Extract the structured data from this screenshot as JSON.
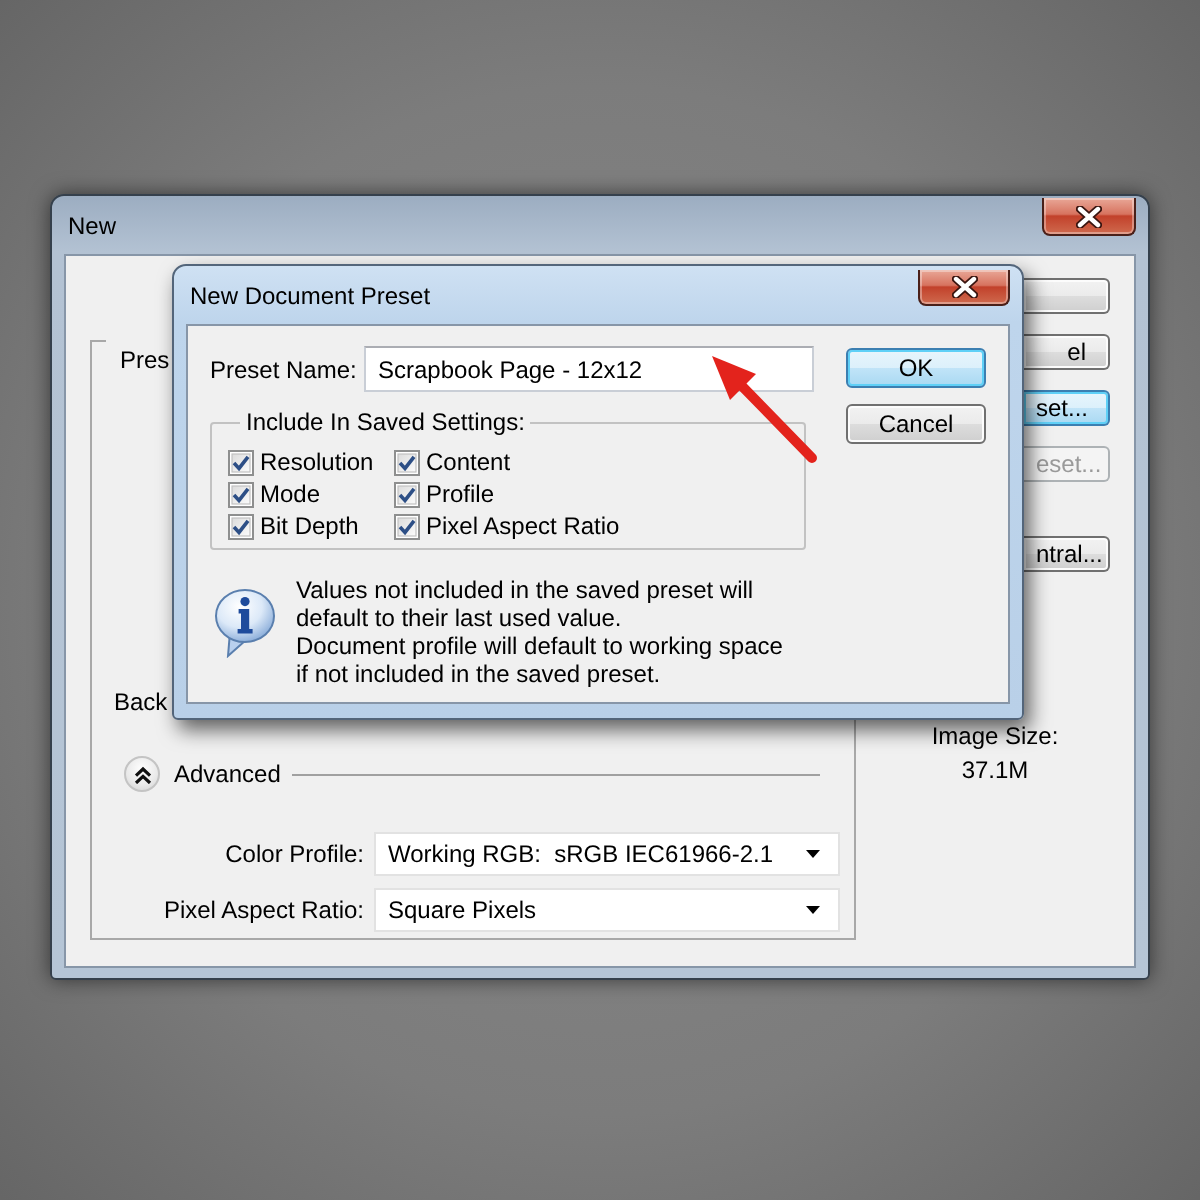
{
  "window": {
    "title": "New",
    "preset_label": "Pres",
    "background_label": "Back",
    "advanced": {
      "label": "Advanced",
      "expanded": true
    },
    "fields": [
      {
        "label": "Color Profile:",
        "value": "Working RGB:  sRGB IEC61966-2.1"
      },
      {
        "label": "Pixel Aspect Ratio:",
        "value": "Square Pixels"
      }
    ],
    "buttons": [
      {
        "focused": false,
        "disabled": false
      },
      {
        "label": "el",
        "focused": false,
        "disabled": false
      },
      {
        "label": "set...",
        "focused": true,
        "disabled": false
      },
      {
        "label": "eset...",
        "focused": false,
        "disabled": true
      },
      {
        "label": "ntral...",
        "focused": false,
        "disabled": false
      }
    ],
    "image_size": {
      "label": "Image Size:",
      "value": "37.1M"
    }
  },
  "dialog": {
    "title": "New Document Preset",
    "preset_name": {
      "label": "Preset Name:",
      "value": "Scrapbook Page - 12x12"
    },
    "include_settings": {
      "title": "Include In Saved Settings:",
      "items": [
        {
          "label": "Resolution",
          "checked": true
        },
        {
          "label": "Content",
          "checked": true
        },
        {
          "label": "Mode",
          "checked": true
        },
        {
          "label": "Profile",
          "checked": true
        },
        {
          "label": "Bit Depth",
          "checked": true
        },
        {
          "label": "Pixel Aspect Ratio",
          "checked": true
        }
      ]
    },
    "note": [
      "Values not included in the saved preset will default to their last used value.",
      "Document profile will default to working space if not included in the saved preset."
    ],
    "buttons": [
      {
        "label": "OK",
        "focused": true
      },
      {
        "label": "Cancel",
        "focused": false
      }
    ]
  }
}
